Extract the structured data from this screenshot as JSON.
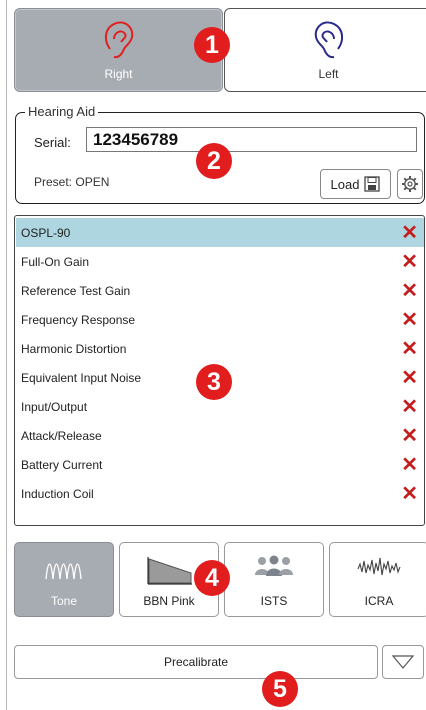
{
  "ear": {
    "right_label": "Right",
    "left_label": "Left",
    "right_color": "#e02020",
    "left_color": "#2a2a8c",
    "selected": "Right"
  },
  "badges": [
    "1",
    "2",
    "3",
    "4",
    "5"
  ],
  "hearing_aid": {
    "legend": "Hearing Aid",
    "serial_label": "Serial:",
    "serial_value": "123456789",
    "preset_label": "Preset:",
    "preset_value": "OPEN",
    "load_label": "Load"
  },
  "tests": {
    "items": [
      {
        "label": "OSPL-90",
        "selected": true
      },
      {
        "label": "Full-On Gain",
        "selected": false
      },
      {
        "label": "Reference Test Gain",
        "selected": false
      },
      {
        "label": "Frequency Response",
        "selected": false
      },
      {
        "label": "Harmonic Distortion",
        "selected": false
      },
      {
        "label": "Equivalent Input Noise",
        "selected": false
      },
      {
        "label": "Input/Output",
        "selected": false
      },
      {
        "label": "Attack/Release",
        "selected": false
      },
      {
        "label": "Battery Current",
        "selected": false
      },
      {
        "label": "Induction Coil",
        "selected": false
      }
    ],
    "remove_glyph": "✕"
  },
  "signals": [
    {
      "label": "Tone",
      "icon": "sine-wave-icon",
      "active": true
    },
    {
      "label": "BBN Pink",
      "icon": "pink-noise-icon",
      "active": false
    },
    {
      "label": "ISTS",
      "icon": "people-icon",
      "active": false
    },
    {
      "label": "ICRA",
      "icon": "waveform-icon",
      "active": false
    }
  ],
  "precalibrate_label": "Precalibrate"
}
